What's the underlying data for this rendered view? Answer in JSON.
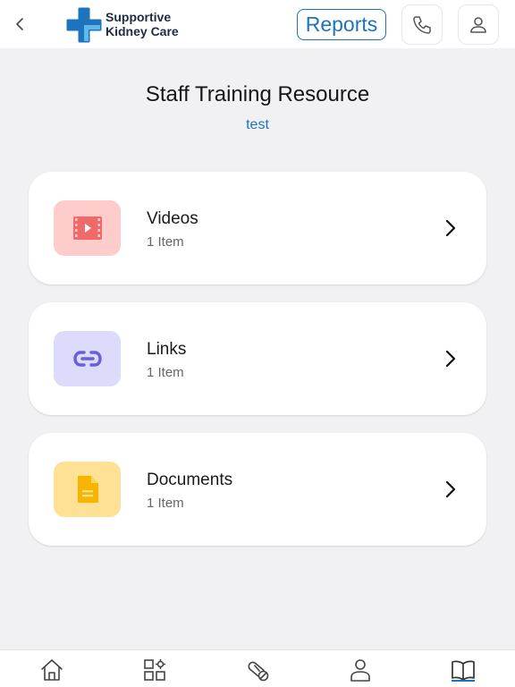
{
  "header": {
    "logo_line1": "Supportive",
    "logo_line2": "Kidney Care",
    "reports_label": "Reports"
  },
  "page": {
    "title": "Staff Training Resource",
    "subtitle": "test"
  },
  "cards": [
    {
      "title": "Videos",
      "count": "1 Item",
      "icon": "video-icon",
      "bg": "#ffcccc",
      "fg": "#f06a6a"
    },
    {
      "title": "Links",
      "count": "1 Item",
      "icon": "link-icon",
      "bg": "#dcdbfb",
      "fg": "#6b5fd8"
    },
    {
      "title": "Documents",
      "count": "1 Item",
      "icon": "document-icon",
      "bg": "#ffe196",
      "fg": "#f7b500"
    }
  ],
  "bottom_nav": {
    "items": [
      "home-icon",
      "grid-icon",
      "medication-icon",
      "person-icon",
      "book-icon"
    ],
    "active": "book-icon"
  },
  "colors": {
    "accent": "#1e73be",
    "logo_blue": "#1e73be",
    "logo_light": "#5fb8e8"
  }
}
